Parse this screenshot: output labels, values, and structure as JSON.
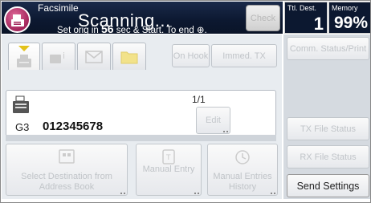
{
  "header": {
    "app_title": "Facsimile",
    "status": "Scanning...",
    "instruction_pre": "Set orig in ",
    "instruction_secs": "56",
    "instruction_post": " sec & Start. To end ⊕.",
    "check_label": "Check"
  },
  "counters": {
    "ttl_dest_label": "Ttl. Dest.",
    "ttl_dest_value": "1",
    "memory_label": "Memory",
    "memory_value": "99%"
  },
  "tabs": [
    {
      "icon": "fax-machine-icon"
    },
    {
      "icon": "info-icon"
    },
    {
      "icon": "envelope-icon"
    },
    {
      "icon": "folder-icon"
    }
  ],
  "header_buttons": {
    "on_hook": "On Hook",
    "immed_tx": "Immed. TX"
  },
  "destination": {
    "page_count": "1/1",
    "edit_label": "Edit",
    "mode": "G3",
    "number": "012345678"
  },
  "bottom_buttons": {
    "select_destination": "Select Destination from Address Book",
    "manual_entry": "Manual Entry",
    "manual_entries_history": "Manual Entries History"
  },
  "right_panel": {
    "comm_status": "Comm. Status/Print",
    "tx_file_status": "TX File Status",
    "rx_file_status": "RX File Status",
    "send_settings": "Send Settings"
  }
}
